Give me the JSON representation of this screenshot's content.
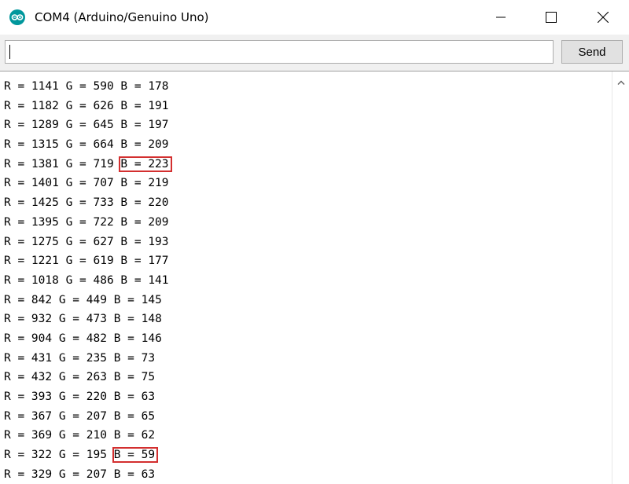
{
  "window": {
    "title": "COM4 (Arduino/Genuino Uno)",
    "icon": "arduino-logo-icon",
    "controls": [
      "minimize-icon",
      "maximize-icon",
      "close-icon"
    ]
  },
  "input": {
    "value": "",
    "send_label": "Send"
  },
  "colors": {
    "highlight": "#d32f2f",
    "logo": "#00979c"
  },
  "output": {
    "lines": [
      {
        "pre": "R = 1141 G = 590 ",
        "hl": "",
        "post": "B = 178"
      },
      {
        "pre": "R = 1182 G = 626 ",
        "hl": "",
        "post": "B = 191"
      },
      {
        "pre": "R = 1289 G = 645 ",
        "hl": "",
        "post": "B = 197"
      },
      {
        "pre": "R = 1315 G = 664 ",
        "hl": "",
        "post": "B = 209"
      },
      {
        "pre": "R = 1381 G = 719 ",
        "hl": "B = 223",
        "post": ""
      },
      {
        "pre": "R = 1401 G = 707 ",
        "hl": "",
        "post": "B = 219"
      },
      {
        "pre": "R = 1425 G = 733 ",
        "hl": "",
        "post": "B = 220"
      },
      {
        "pre": "R = 1395 G = 722 ",
        "hl": "",
        "post": "B = 209"
      },
      {
        "pre": "R = 1275 G = 627 ",
        "hl": "",
        "post": "B = 193"
      },
      {
        "pre": "R = 1221 G = 619 ",
        "hl": "",
        "post": "B = 177"
      },
      {
        "pre": "R = 1018 G = 486 ",
        "hl": "",
        "post": "B = 141"
      },
      {
        "pre": "R = 842 G = 449 ",
        "hl": "",
        "post": "B = 145"
      },
      {
        "pre": "R = 932 G = 473 ",
        "hl": "",
        "post": "B = 148"
      },
      {
        "pre": "R = 904 G = 482 ",
        "hl": "",
        "post": "B = 146"
      },
      {
        "pre": "R = 431 G = 235 ",
        "hl": "",
        "post": "B = 73"
      },
      {
        "pre": "R = 432 G = 263 ",
        "hl": "",
        "post": "B = 75"
      },
      {
        "pre": "R = 393 G = 220 ",
        "hl": "",
        "post": "B = 63"
      },
      {
        "pre": "R = 367 G = 207 ",
        "hl": "",
        "post": "B = 65"
      },
      {
        "pre": "R = 369 G = 210 ",
        "hl": "",
        "post": "B = 62"
      },
      {
        "pre": "R = 322 G = 195 ",
        "hl": "B = 59",
        "post": ""
      },
      {
        "pre": "R = 329 G = 207 ",
        "hl": "",
        "post": "B = 63"
      }
    ]
  }
}
